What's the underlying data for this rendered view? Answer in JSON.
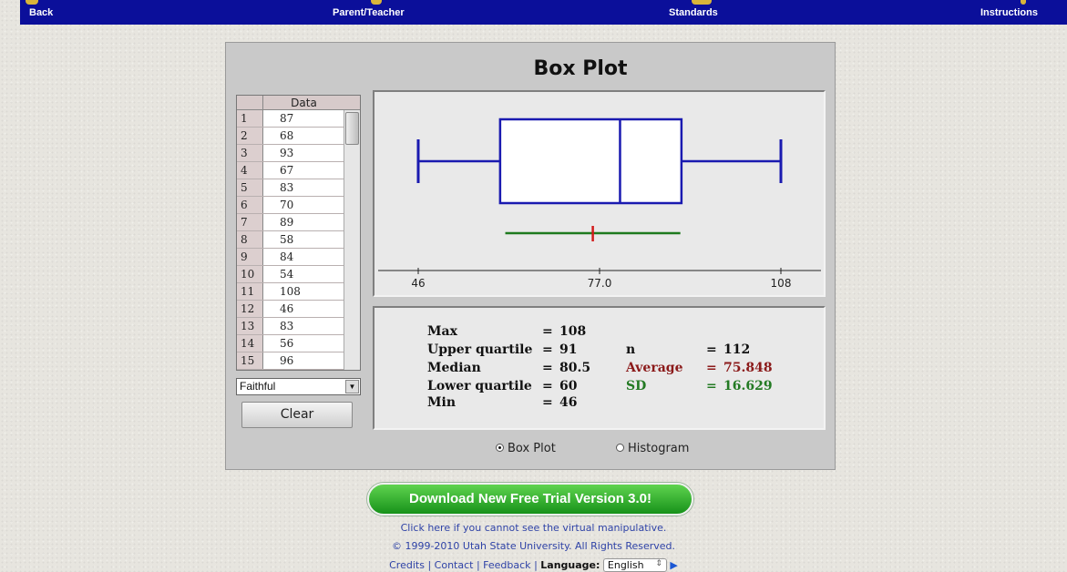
{
  "nav": {
    "back": "Back",
    "parent_teacher": "Parent/Teacher",
    "standards": "Standards",
    "instructions": "Instructions"
  },
  "app": {
    "title": "Box Plot",
    "table_header": "Data",
    "rows": [
      {
        "n": "1",
        "v": "87"
      },
      {
        "n": "2",
        "v": "68"
      },
      {
        "n": "3",
        "v": "93"
      },
      {
        "n": "4",
        "v": "67"
      },
      {
        "n": "5",
        "v": "83"
      },
      {
        "n": "6",
        "v": "70"
      },
      {
        "n": "7",
        "v": "89"
      },
      {
        "n": "8",
        "v": "58"
      },
      {
        "n": "9",
        "v": "84"
      },
      {
        "n": "10",
        "v": "54"
      },
      {
        "n": "11",
        "v": "108"
      },
      {
        "n": "12",
        "v": "46"
      },
      {
        "n": "13",
        "v": "83"
      },
      {
        "n": "14",
        "v": "56"
      },
      {
        "n": "15",
        "v": "96"
      }
    ],
    "dataset": "Faithful",
    "clear_label": "Clear",
    "axis_ticks": [
      "46",
      "77.0",
      "108"
    ],
    "stats": {
      "max_label": "Max",
      "max_eq": "=",
      "max": "108",
      "uq_label": "Upper quartile",
      "uq_eq": "=",
      "uq": "91",
      "median_label": "Median",
      "median_eq": "=",
      "median": "80.5",
      "lq_label": "Lower quartile",
      "lq_eq": "=",
      "lq": "60",
      "min_label": "Min",
      "min_eq": "=",
      "min": "46",
      "n_label": "n",
      "n_eq": "=",
      "n": "112",
      "avg_label": "Average",
      "avg_eq": "=",
      "avg": "75.848",
      "sd_label": "SD",
      "sd_eq": "=",
      "sd": "16.629"
    },
    "view_boxplot": "Box Plot",
    "view_histogram": "Histogram",
    "selected_view": "Box Plot"
  },
  "chart_data": {
    "type": "boxplot",
    "min": 46,
    "lower_quartile": 60,
    "median": 80.5,
    "upper_quartile": 91,
    "max": 108,
    "mean": 75.848,
    "sd": 16.629,
    "n": 112,
    "xlim": [
      46,
      108
    ]
  },
  "footer": {
    "download": "Download New Free Trial Version 3.0!",
    "help": "Click here if you cannot see the virtual manipulative.",
    "copyright": "© 1999-2010 Utah State University. All Rights Reserved.",
    "credits": "Credits",
    "contact": "Contact",
    "feedback": "Feedback",
    "language_label": "Language:",
    "language_value": "English",
    "sep": "|"
  },
  "colors": {
    "nav_bg": "#0b0f9a",
    "box_stroke": "#1a1ab0",
    "mean_line": "#1e7a1e",
    "mean_marker": "#d21b1b",
    "average_text": "#8b1a1a",
    "sd_text": "#237a23",
    "download_green": "#2bb12b"
  }
}
